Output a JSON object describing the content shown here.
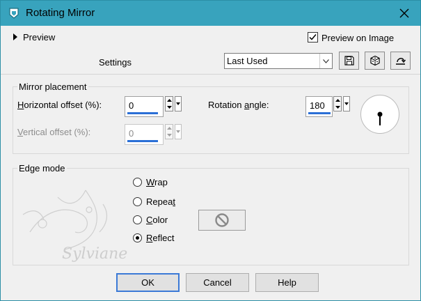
{
  "window": {
    "title": "Rotating Mirror"
  },
  "header": {
    "preview_label": "Preview",
    "preview_on_image_label": "Preview on Image",
    "preview_on_image_checked": true,
    "settings_label": "Settings",
    "settings_value": "Last Used",
    "toolbar_icons": [
      "save-icon",
      "dice-icon",
      "reset-icon"
    ]
  },
  "mirror_placement": {
    "title": "Mirror placement",
    "horizontal_offset": {
      "label_prefix": "",
      "mnemonic": "H",
      "label_rest": "orizontal offset (%):",
      "value": "0"
    },
    "vertical_offset": {
      "mnemonic": "V",
      "label_rest": "ertical offset (%):",
      "value": "0",
      "enabled": false
    },
    "rotation_angle": {
      "label_prefix": "Rotation ",
      "mnemonic": "a",
      "label_rest": "ngle:",
      "value": "180"
    }
  },
  "edge_mode": {
    "title": "Edge mode",
    "options": [
      {
        "mnemonic": "W",
        "rest": "rap",
        "selected": false
      },
      {
        "mnemonic": "",
        "rest": "Repeat",
        "selected": false
      },
      {
        "mnemonic": "C",
        "rest": "olor",
        "selected": false
      },
      {
        "mnemonic": "R",
        "rest": "eflect",
        "selected": true
      }
    ],
    "repeat_prefix": "Repea",
    "repeat_mnemonic": "t"
  },
  "watermark": {
    "text": "Sylviane"
  },
  "buttons": {
    "ok": "OK",
    "cancel": "Cancel",
    "help": "Help"
  },
  "colors": {
    "titlebar": "#38a3bd",
    "accent": "#2a6fd6"
  }
}
